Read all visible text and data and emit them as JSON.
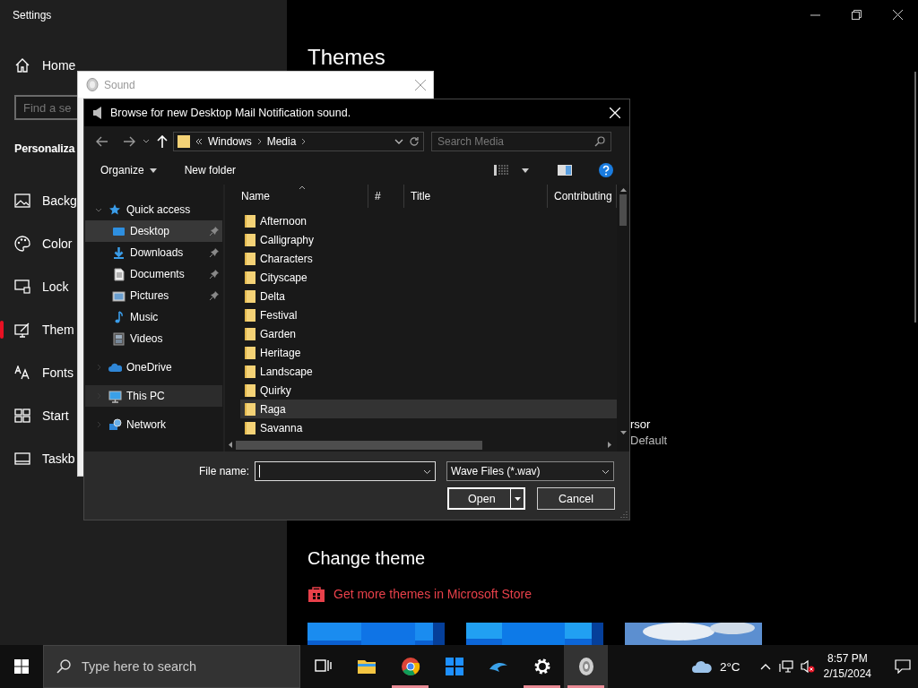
{
  "settings": {
    "title": "Settings",
    "home": "Home",
    "search": {
      "placeholder": "Find a se"
    },
    "section": "Personaliza",
    "nav": [
      {
        "label": "Backg",
        "selected": false
      },
      {
        "label": "Color",
        "selected": false
      },
      {
        "label": "Lock",
        "selected": false
      },
      {
        "label": "Them",
        "selected": true
      },
      {
        "label": "Fonts",
        "selected": false
      },
      {
        "label": "Start",
        "selected": false
      },
      {
        "label": "Taskb",
        "selected": false
      }
    ],
    "page": {
      "title": "Themes",
      "cursor_label": "rsor",
      "cursor_value": "Default",
      "change_theme": "Change theme",
      "store_link": "Get more themes in Microsoft Store"
    }
  },
  "sound_window": {
    "title": "Sound"
  },
  "browse_dialog": {
    "title": "Browse for new Desktop Mail Notification sound.",
    "address": {
      "path": [
        "Windows",
        "Media"
      ]
    },
    "search": {
      "placeholder": "Search Media"
    },
    "toolbar": [
      "Organize",
      "New folder"
    ],
    "nav_tree": [
      {
        "label": "Quick access",
        "expanded": true,
        "selected": false,
        "hovered": false,
        "children": [
          {
            "label": "Desktop",
            "pinned": true,
            "selected": false,
            "hovered": true
          },
          {
            "label": "Downloads",
            "pinned": true,
            "selected": false,
            "hovered": false
          },
          {
            "label": "Documents",
            "pinned": true,
            "selected": false,
            "hovered": false
          },
          {
            "label": "Pictures",
            "pinned": true,
            "selected": false,
            "hovered": false
          },
          {
            "label": "Music",
            "pinned": false,
            "selected": false,
            "hovered": false
          },
          {
            "label": "Videos",
            "pinned": false,
            "selected": false,
            "hovered": false
          }
        ]
      },
      {
        "label": "OneDrive",
        "expanded": false,
        "selected": false,
        "hovered": false
      },
      {
        "label": "This PC",
        "expanded": false,
        "selected": true,
        "hovered": false
      },
      {
        "label": "Network",
        "expanded": false,
        "selected": false,
        "hovered": false
      }
    ],
    "columns": [
      "Name",
      "#",
      "Title",
      "Contributing"
    ],
    "files": [
      {
        "name": "Afternoon",
        "highlighted": false
      },
      {
        "name": "Calligraphy",
        "highlighted": false
      },
      {
        "name": "Characters",
        "highlighted": false
      },
      {
        "name": "Cityscape",
        "highlighted": false
      },
      {
        "name": "Delta",
        "highlighted": false
      },
      {
        "name": "Festival",
        "highlighted": false
      },
      {
        "name": "Garden",
        "highlighted": false
      },
      {
        "name": "Heritage",
        "highlighted": false
      },
      {
        "name": "Landscape",
        "highlighted": false
      },
      {
        "name": "Quirky",
        "highlighted": false
      },
      {
        "name": "Raga",
        "highlighted": true
      },
      {
        "name": "Savanna",
        "highlighted": false
      }
    ],
    "file_name_label": "File name:",
    "file_type": "Wave Files (*.wav)",
    "buttons": [
      "Open",
      "Cancel"
    ]
  },
  "taskbar": {
    "search": {
      "placeholder": "Type here to search"
    },
    "apps": [
      {
        "running": false,
        "active": false
      },
      {
        "running": false,
        "active": false
      },
      {
        "running": true,
        "active": false
      },
      {
        "running": false,
        "active": false
      },
      {
        "running": false,
        "active": false
      },
      {
        "running": true,
        "active": false
      },
      {
        "running": true,
        "active": true
      }
    ],
    "weather": "2°C",
    "time": "8:57 PM",
    "date": "2/15/2024"
  }
}
